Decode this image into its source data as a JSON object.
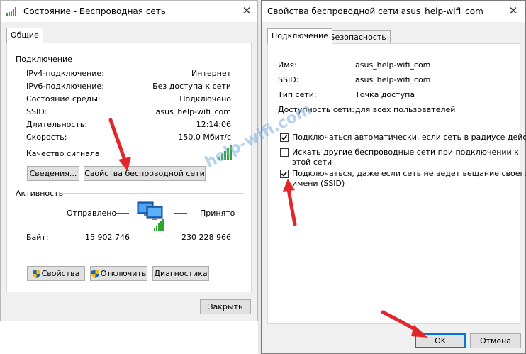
{
  "watermark": "help-wifi.com",
  "status_window": {
    "title": "Состояние - Беспроводная сеть",
    "tab_general": "Общие",
    "connection_group": "Подключение",
    "rows": [
      {
        "label": "IPv4-подключение:",
        "value": "Интернет"
      },
      {
        "label": "IPv6-подключение:",
        "value": "Без доступа к сети"
      },
      {
        "label": "Состояние среды:",
        "value": "Подключено"
      },
      {
        "label": "SSID:",
        "value": "asus_help-wifi_com"
      },
      {
        "label": "Длительность:",
        "value": "12:14:06"
      },
      {
        "label": "Скорость:",
        "value": "150.0 Мбит/с"
      }
    ],
    "signal_label": "Качество сигнала:",
    "signal_bars": 5,
    "details_button": "Сведения...",
    "wireless_props_button": "Свойства беспроводной сети",
    "activity_group": "Активность",
    "sent_label": "Отправлено",
    "received_label": "Принято",
    "bytes_label": "Байт:",
    "bytes_sent": "15 902 746",
    "bytes_received": "230 228 966",
    "properties_button": "Свойства",
    "disconnect_button": "Отключить",
    "diagnose_button": "Диагностика",
    "close_button": "Закрыть"
  },
  "props_window": {
    "title": "Свойства беспроводной сети asus_help-wifi_com",
    "tab_connection": "Подключение",
    "tab_security": "Безопасность",
    "fields": [
      {
        "label": "Имя:",
        "value": "asus_help-wifi_com"
      },
      {
        "label": "SSID:",
        "value": "asus_help-wifi_com"
      },
      {
        "label": "Тип сети:",
        "value": "Точка доступа"
      },
      {
        "label": "Доступность сети:",
        "value": "для всех пользователей"
      }
    ],
    "checkbox_auto_label": "Подключаться автоматически, если сеть в радиусе действия",
    "checkbox_auto_checked": true,
    "checkbox_other_line1": "Искать другие беспроводные сети при подключении к",
    "checkbox_other_line2": "этой сети",
    "checkbox_other_checked": false,
    "checkbox_hidden_line1": "Подключаться, даже если сеть не ведет вещание своего",
    "checkbox_hidden_line2": "имени (SSID)",
    "checkbox_hidden_checked": true,
    "ok_button": "OK",
    "cancel_button": "Отмена"
  },
  "colors": {
    "accent": "#0078d7",
    "arrow": "#e3262b",
    "signal": "#2fa52f"
  }
}
